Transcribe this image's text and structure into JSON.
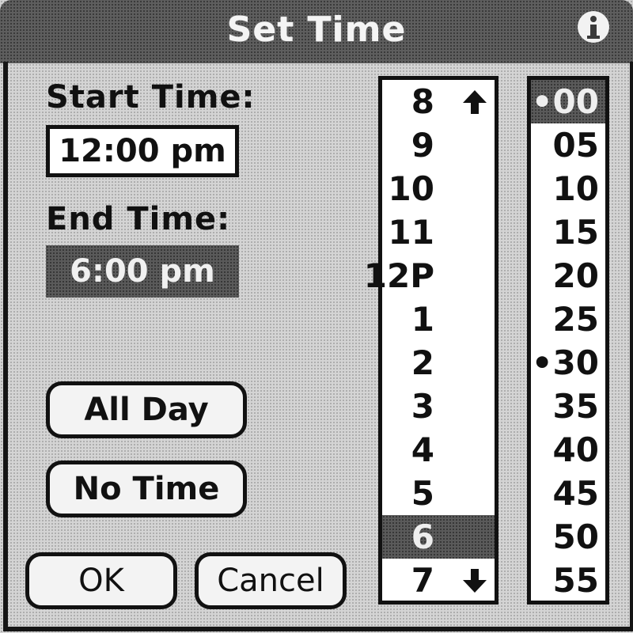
{
  "dialog": {
    "title": "Set Time"
  },
  "start": {
    "label": "Start Time:",
    "value": "12:00 pm"
  },
  "end": {
    "label": "End Time:",
    "value": "6:00 pm"
  },
  "buttons": {
    "all_day": "All Day",
    "no_time": "No Time",
    "ok": "OK",
    "cancel": "Cancel"
  },
  "hours": {
    "items": [
      "8",
      "9",
      "10",
      "11",
      "12P",
      "1",
      "2",
      "3",
      "4",
      "5",
      "6",
      "7"
    ],
    "selected": "6",
    "scroll_up_icon": "arrow-up-icon",
    "scroll_down_icon": "arrow-down-icon"
  },
  "minutes": {
    "items": [
      "•00",
      "05",
      "10",
      "15",
      "20",
      "25",
      "•30",
      "35",
      "40",
      "45",
      "50",
      "55"
    ],
    "selected": "•00"
  },
  "icons": {
    "info": "info-icon"
  }
}
